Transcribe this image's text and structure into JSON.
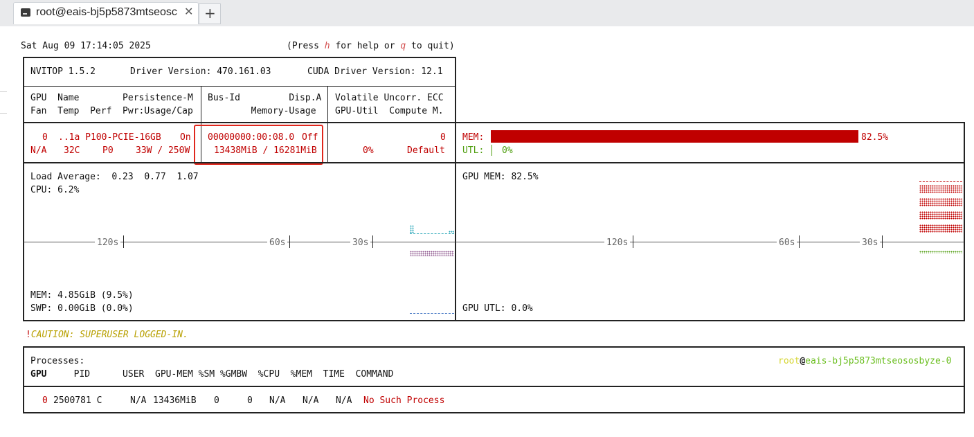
{
  "window": {
    "tab_title": "root@eais-bj5p5873mtseosc",
    "close_glyph": "✕",
    "newtab_glyph": "+"
  },
  "header": {
    "datetime": "Sat Aug 09 17:14:05 2025",
    "help_prefix": "(Press ",
    "help_key": "h",
    "help_mid": " for help or ",
    "quit_key": "q",
    "help_suffix": " to quit)"
  },
  "info": {
    "nvitop": "NVITOP 1.5.2",
    "driver": "Driver Version: 470.161.03",
    "cuda": "CUDA Driver Version: 12.1"
  },
  "gpu_table_header": {
    "col1_line1": "GPU  Name        Persistence-M",
    "col1_line2": "Fan  Temp  Perf  Pwr:Usage/Cap",
    "col2_line1": "Bus-Id         Disp.A",
    "col2_line2": "        Memory-Usage",
    "col3_line1": "Volatile Uncorr. ECC",
    "col3_line2": "GPU-Util  Compute M."
  },
  "gpu0": {
    "index": "0",
    "name": "..1a P100-PCIE-16GB",
    "persistence": "On",
    "fan": "N/A",
    "temp": "32C",
    "perf": "P0",
    "power": "33W / 250W",
    "bus_id": "00000000:00:08.0",
    "disp": "Off",
    "memory": "13438MiB / 16281MiB",
    "ecc": "0",
    "util": "0%",
    "compute_mode": "Default",
    "mem_label": "MEM:",
    "mem_percent": "82.5%",
    "mem_fraction": 0.825,
    "utl_label": "UTL:",
    "utl_percent": "0%"
  },
  "host": {
    "load_average": "Load Average:  0.23  0.77  1.07",
    "cpu": "CPU: 6.2%",
    "mem": "MEM: 4.85GiB (9.5%)",
    "swp": "SWP: 0.00GiB (0.0%)",
    "t120": "120s",
    "t60": "60s",
    "t30": "30s"
  },
  "gpu_graph": {
    "mem": "GPU MEM: 82.5%",
    "utl": "GPU UTL: 0.0%",
    "t120": "120s",
    "t60": "60s",
    "t30": "30s"
  },
  "caution": {
    "bang": "!",
    "text": "CAUTION: SUPERUSER LOGGED-IN."
  },
  "processes": {
    "title": "Processes:",
    "user_host_user": "root",
    "user_host_at": "@",
    "user_host_host": "eais-bj5p5873mtseososbyze-0",
    "header_gpu": "GPU",
    "header_rest": "     PID      USER  GPU-MEM %SM %GMBW  %CPU  %MEM  TIME  COMMAND",
    "rows": [
      {
        "gpu": "0",
        "pid_type": "2500781 C",
        "user": "N/A",
        "gpu_mem": "13436MiB",
        "sm": "0",
        "gmbw": "0",
        "cpu": "N/A",
        "mem": "N/A",
        "time": "N/A",
        "command": "No Such Process"
      }
    ]
  },
  "colors": {
    "accent_red": "#c00000",
    "highlight": "#e0271d",
    "util_green": "#4f9e0f",
    "caution_gold": "#b8a000",
    "host_user_color": "#d6d633",
    "host_name_color": "#6abe1e"
  }
}
